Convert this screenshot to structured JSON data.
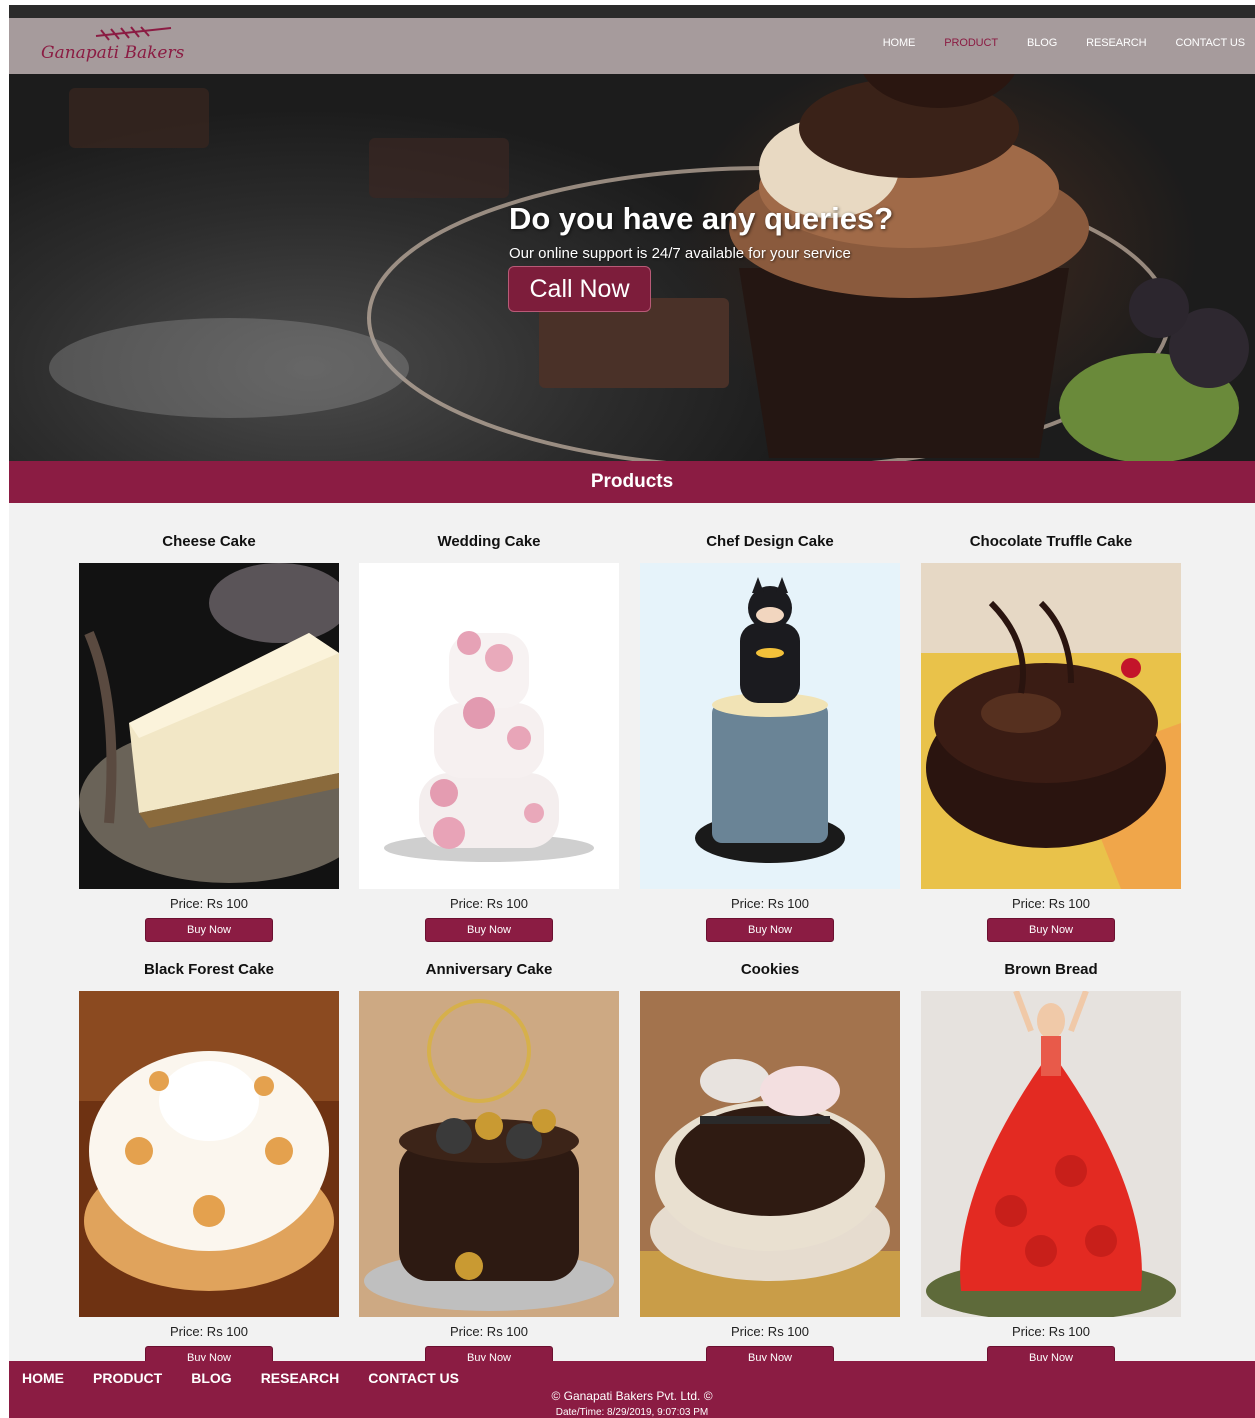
{
  "brand": {
    "name": "Ganapati Bakers"
  },
  "nav": {
    "items": [
      {
        "label": "HOME",
        "active": false
      },
      {
        "label": "PRODUCT",
        "active": true
      },
      {
        "label": "BLOG",
        "active": false
      },
      {
        "label": "RESEARCH",
        "active": false
      },
      {
        "label": "CONTACT US",
        "active": false
      }
    ]
  },
  "hero": {
    "title": "Do you have any queries?",
    "subtitle": "Our online support is 24/7 available for your service",
    "button_label": "Call Now"
  },
  "products": {
    "heading": "Products",
    "buy_label": "Buy Now",
    "items": [
      {
        "name": "Cheese Cake",
        "price": "Price: Rs 100"
      },
      {
        "name": "Wedding Cake",
        "price": "Price: Rs 100"
      },
      {
        "name": "Chef Design Cake",
        "price": "Price: Rs 100"
      },
      {
        "name": "Chocolate Truffle Cake",
        "price": "Price: Rs 100"
      },
      {
        "name": "Black Forest Cake",
        "price": "Price: Rs 100"
      },
      {
        "name": "Anniversary Cake",
        "price": "Price: Rs 100"
      },
      {
        "name": "Cookies",
        "price": "Price: Rs 100"
      },
      {
        "name": "Brown Bread",
        "price": "Price: Rs 100"
      }
    ]
  },
  "footer": {
    "links": [
      "HOME",
      "PRODUCT",
      "BLOG",
      "RESEARCH",
      "CONTACT US"
    ],
    "copyright": "© Ganapati Bakers Pvt. Ltd. ©",
    "datetime": "Date/Time: 8/29/2019, 9:07:03 PM"
  },
  "colors": {
    "brand": "#8b1c43",
    "navbar": "#a69b9c",
    "page_bg": "#f2f2f2"
  }
}
